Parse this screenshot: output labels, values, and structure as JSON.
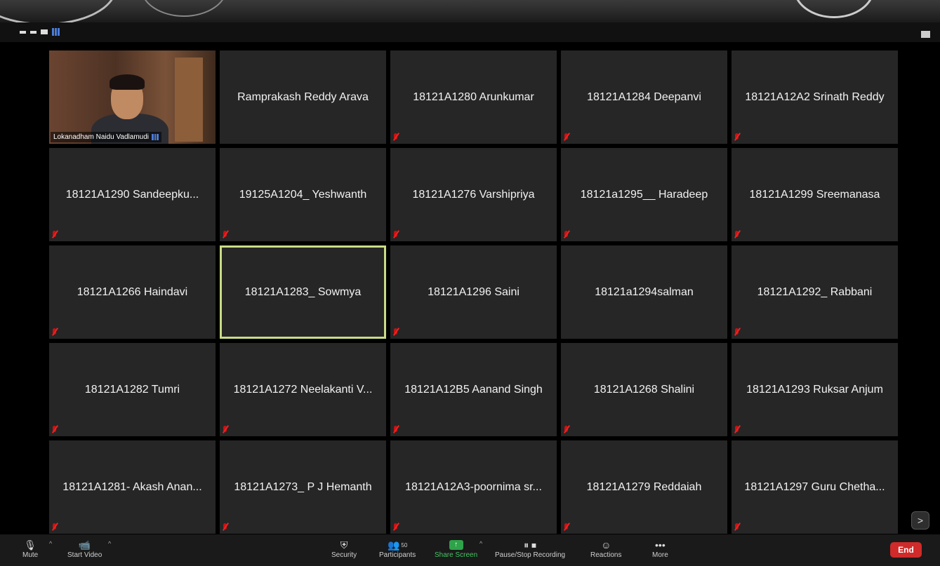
{
  "top_view_icons": [
    "minimize-icon",
    "speaker-view-icon",
    "strip-view-icon",
    "gallery-view-icon"
  ],
  "self_video": {
    "name": "Lokanadham Naidu Vadlamudi"
  },
  "tiles": [
    "Ramprakash Reddy Arava",
    "18121A1280 Arunkumar",
    "18121A1284 Deepanvi",
    "18121A12A2 Srinath Reddy",
    "18121A1290 Sandeepku...",
    "19125A1204_ Yeshwanth",
    "18121A1276 Varshipriya",
    "18121a1295__ Haradeep",
    "18121A1299 Sreemanasa",
    "18121A1266 Haindavi",
    "18121A1283_ Sowmya",
    "18121A1296 Saini",
    "18121a1294salman",
    "18121A1292_ Rabbani",
    "18121A1282 Tumri",
    "18121A1272 Neelakanti V...",
    "18121A12B5 Aanand Singh",
    "18121A1268 Shalini",
    "18121A1293 Ruksar Anjum",
    "18121A1281- Akash Anan...",
    "18121A1273_ P J Hemanth",
    "18121A12A3-poornima sr...",
    "18121A1279 Reddaiah",
    "18121A1297 Guru Chetha..."
  ],
  "bottom_bar": {
    "mute": "Mute",
    "start_video": "Start Video",
    "security": "Security",
    "participants": "Participants",
    "participants_count": "50",
    "share_screen": "Share Screen",
    "recording": "Pause/Stop Recording",
    "reactions": "Reactions",
    "more": "More",
    "end": "End"
  },
  "next_page": ">",
  "colors": {
    "active_speaker_border": "#c9dc86",
    "share_green": "#2fa34a",
    "end_red": "#d02a2a",
    "tile_bg": "#262626"
  }
}
